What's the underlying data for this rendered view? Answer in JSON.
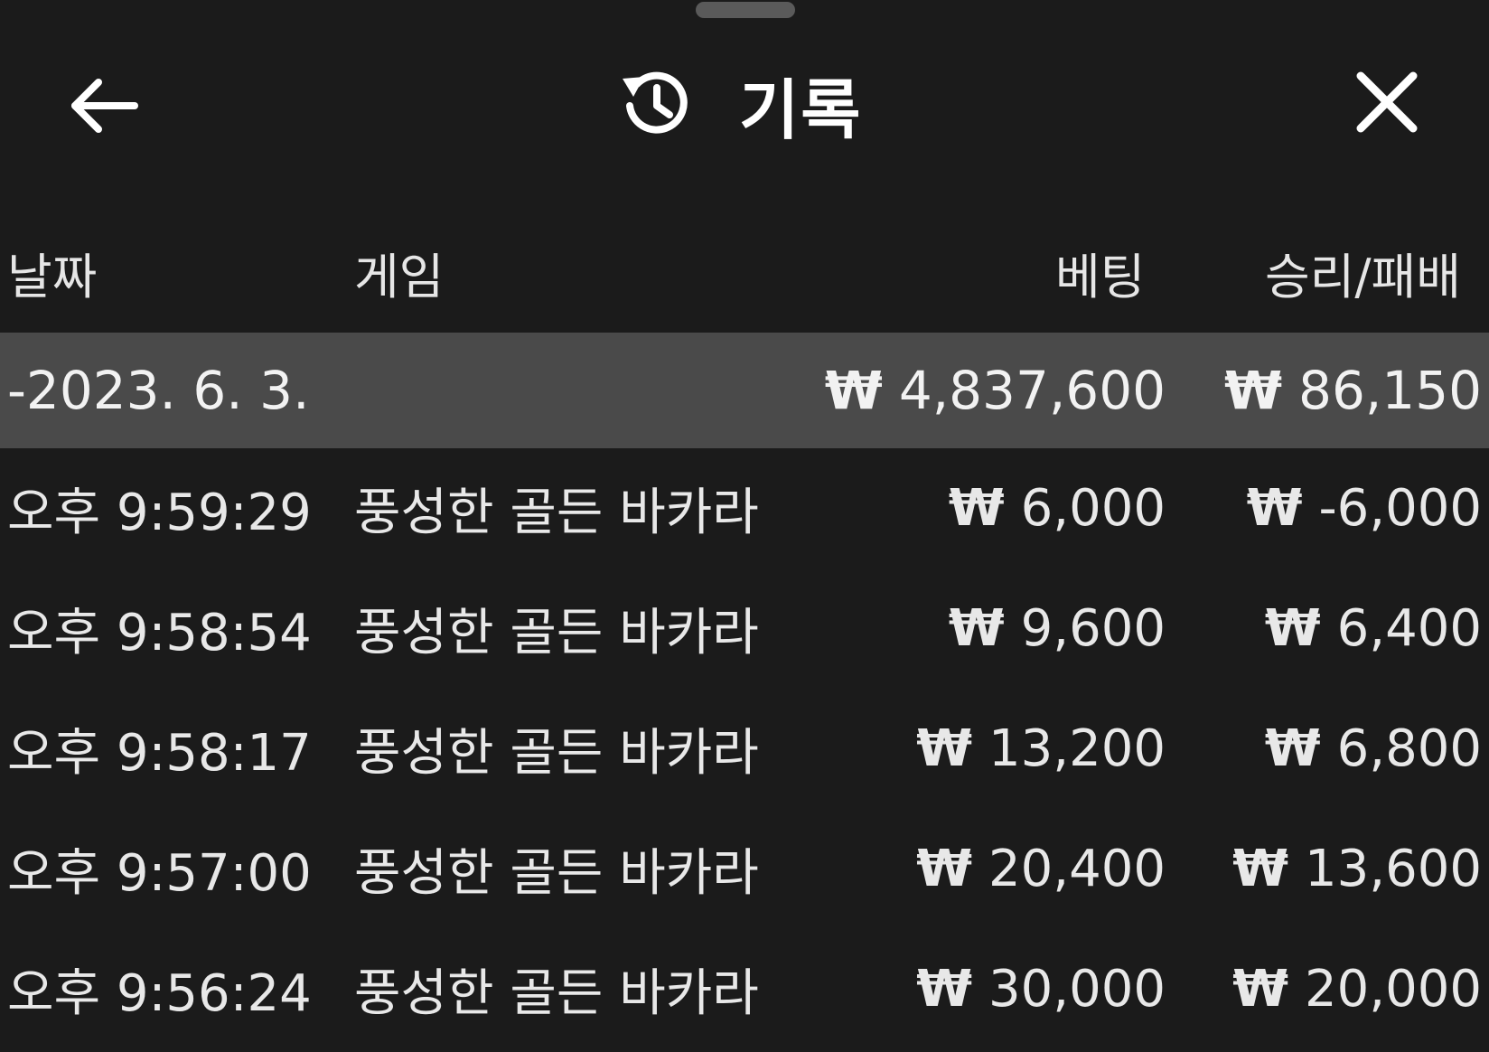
{
  "header": {
    "title": "기록",
    "back_icon": "arrow-left-icon",
    "history_icon": "history-icon",
    "close_icon": "close-icon"
  },
  "columns": {
    "date": "날짜",
    "game": "게임",
    "bet": "베팅",
    "win_loss": "승리/패배"
  },
  "summary": {
    "date": "-2023. 6. 3.",
    "currency": "₩",
    "bet": "4,837,600",
    "win_loss": "86,150"
  },
  "rows": [
    {
      "time": "오후 9:59:29",
      "game": "풍성한 골든 바카라",
      "currency": "₩",
      "bet": "6,000",
      "win_loss": "-6,000"
    },
    {
      "time": "오후 9:58:54",
      "game": "풍성한 골든 바카라",
      "currency": "₩",
      "bet": "9,600",
      "win_loss": "6,400"
    },
    {
      "time": "오후 9:58:17",
      "game": "풍성한 골든 바카라",
      "currency": "₩",
      "bet": "13,200",
      "win_loss": "6,800"
    },
    {
      "time": "오후 9:57:00",
      "game": "풍성한 골든 바카라",
      "currency": "₩",
      "bet": "20,400",
      "win_loss": "13,600"
    },
    {
      "time": "오후 9:56:24",
      "game": "풍성한 골든 바카라",
      "currency": "₩",
      "bet": "30,000",
      "win_loss": "20,000"
    }
  ],
  "colors": {
    "background": "#1b1b1b",
    "summary_background": "#4a4a4a",
    "text": "#e8e8e8"
  }
}
